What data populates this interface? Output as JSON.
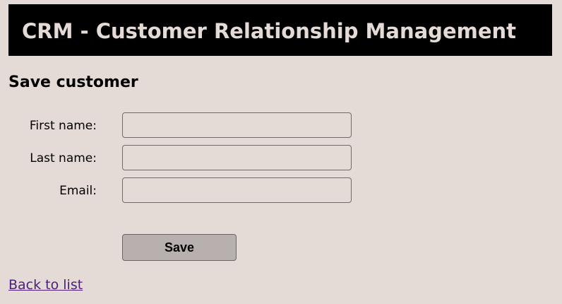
{
  "header": {
    "title": "CRM - Customer Relationship Management"
  },
  "form": {
    "title": "Save customer",
    "fields": [
      {
        "label": "First name:",
        "value": "",
        "placeholder": ""
      },
      {
        "label": "Last name:",
        "value": "",
        "placeholder": ""
      },
      {
        "label": "Email:",
        "value": "",
        "placeholder": ""
      }
    ],
    "save_label": "Save"
  },
  "footer": {
    "back_link": "Back to list"
  },
  "colors": {
    "background": "#e4dad6",
    "header_background": "#000000",
    "header_text": "#e4dad6",
    "button_background": "#b8b0ae",
    "link": "#4d1d7a"
  }
}
